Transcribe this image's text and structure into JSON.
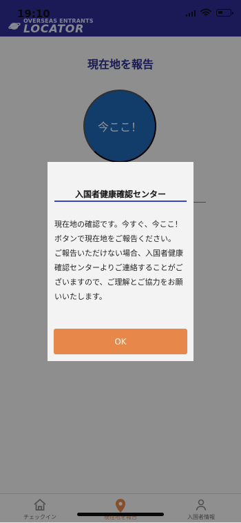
{
  "status_bar": {
    "time": "19:10"
  },
  "header": {
    "logo_top": "OVERSEAS ENTRANTS",
    "logo_bottom": "LOCATOR"
  },
  "page": {
    "title": "現在地を報告",
    "report_button_label": "今ここ！"
  },
  "dialog": {
    "title": "入国者健康確認センター",
    "paragraph_1": "現在地の確認です。今すぐ、今ここ！ボタンで現在地をご報告ください。",
    "paragraph_2": "ご報告いただけない場合、入国者健康確認センターよりご連絡することがございますので、ご理解とご協力をお願いいたします。",
    "ok_label": "OK"
  },
  "tabbar": {
    "items": [
      {
        "label": "チェックイン"
      },
      {
        "label": "現在地を報告"
      },
      {
        "label": "入国者情報"
      }
    ]
  },
  "colors": {
    "header_bg": "#2f2d95",
    "title_text": "#2b2d8d",
    "report_button_bg": "#1f69b8",
    "dialog_underline": "#3744c5",
    "ok_button_bg": "#e8874a",
    "active_tab": "#e8874a"
  },
  "icons": {
    "wifi": "wifi-icon",
    "battery": "battery-icon",
    "planet": "planet-icon",
    "checkin": "house-icon",
    "report": "location-pin-icon",
    "profile": "person-icon"
  }
}
